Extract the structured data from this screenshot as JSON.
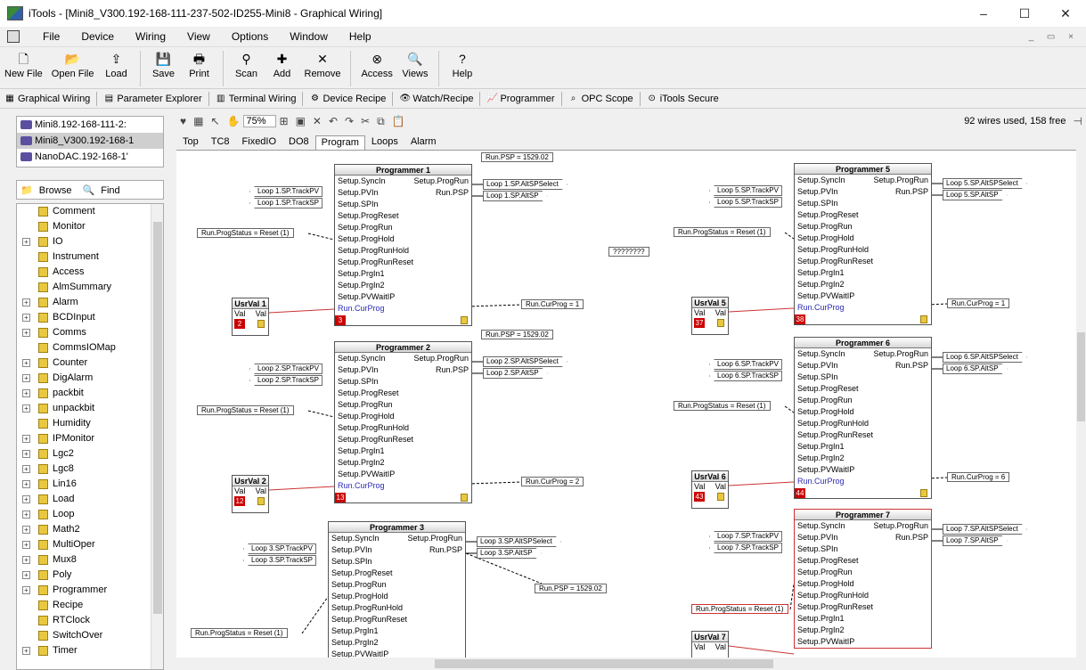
{
  "window": {
    "title": "iTools - [Mini8_V300.192-168-111-237-502-ID255-Mini8 - Graphical Wiring]",
    "min": "–",
    "max": "☐",
    "close": "✕"
  },
  "menu": [
    "File",
    "Device",
    "Wiring",
    "View",
    "Options",
    "Window",
    "Help"
  ],
  "toolbar": [
    {
      "label": "New File",
      "icon": "new-file-icon",
      "glyph": "🗋"
    },
    {
      "label": "Open File",
      "icon": "open-file-icon",
      "glyph": "📂"
    },
    {
      "label": "Load",
      "icon": "load-icon",
      "glyph": "⇪"
    },
    {
      "label": "Save",
      "icon": "save-icon",
      "glyph": "💾"
    },
    {
      "label": "Print",
      "icon": "print-icon",
      "glyph": "🖶"
    },
    {
      "label": "Scan",
      "icon": "scan-icon",
      "glyph": "⚲"
    },
    {
      "label": "Add",
      "icon": "add-icon",
      "glyph": "✚"
    },
    {
      "label": "Remove",
      "icon": "remove-icon",
      "glyph": "✕"
    },
    {
      "label": "Access",
      "icon": "access-icon",
      "glyph": "⊗"
    },
    {
      "label": "Views",
      "icon": "views-icon",
      "glyph": "🔍"
    },
    {
      "label": "Help",
      "icon": "help-icon",
      "glyph": "?"
    }
  ],
  "views": [
    "Graphical Wiring",
    "Parameter Explorer",
    "Terminal Wiring",
    "Device Recipe",
    "Watch/Recipe",
    "Programmer",
    "OPC Scope",
    "iTools Secure"
  ],
  "devices": [
    "Mini8.192-168-111-2:",
    "Mini8_V300.192-168-1",
    "NanoDAC.192-168-1'"
  ],
  "browse": "Browse",
  "find": "Find",
  "tree": [
    {
      "label": "Comment",
      "exp": false
    },
    {
      "label": "Monitor",
      "exp": false
    },
    {
      "label": "IO",
      "exp": true
    },
    {
      "label": "Instrument",
      "exp": false
    },
    {
      "label": "Access",
      "exp": false
    },
    {
      "label": "AlmSummary",
      "exp": false
    },
    {
      "label": "Alarm",
      "exp": true
    },
    {
      "label": "BCDInput",
      "exp": true
    },
    {
      "label": "Comms",
      "exp": true
    },
    {
      "label": "CommsIOMap",
      "exp": false
    },
    {
      "label": "Counter",
      "exp": true
    },
    {
      "label": "DigAlarm",
      "exp": true
    },
    {
      "label": "packbit",
      "exp": true
    },
    {
      "label": "unpackbit",
      "exp": true
    },
    {
      "label": "Humidity",
      "exp": false
    },
    {
      "label": "IPMonitor",
      "exp": true
    },
    {
      "label": "Lgc2",
      "exp": true
    },
    {
      "label": "Lgc8",
      "exp": true
    },
    {
      "label": "Lin16",
      "exp": true
    },
    {
      "label": "Load",
      "exp": true
    },
    {
      "label": "Loop",
      "exp": true
    },
    {
      "label": "Math2",
      "exp": true
    },
    {
      "label": "MultiOper",
      "exp": true
    },
    {
      "label": "Mux8",
      "exp": true
    },
    {
      "label": "Poly",
      "exp": true
    },
    {
      "label": "Programmer",
      "exp": true
    },
    {
      "label": "Recipe",
      "exp": false
    },
    {
      "label": "RTClock",
      "exp": false
    },
    {
      "label": "SwitchOver",
      "exp": false
    },
    {
      "label": "Timer",
      "exp": true
    }
  ],
  "zoom": "75%",
  "wires": "92 wires used, 158 free",
  "sheets": [
    "Top",
    "TC8",
    "FixedIO",
    "DO8",
    "Program",
    "Loops",
    "Alarm"
  ],
  "rows": [
    "Setup.SyncIn",
    "Setup.PVIn",
    "Setup.SPIn",
    "Setup.ProgReset",
    "Setup.ProgRun",
    "Setup.ProgHold",
    "Setup.ProgRunHold",
    "Setup.ProgRunReset",
    "Setup.PrgIn1",
    "Setup.PrgIn2",
    "Setup.PVWaitIP",
    "Run.CurProg"
  ],
  "outs": [
    "Setup.ProgRun",
    "Run.PSP"
  ],
  "programmers": [
    {
      "title": "Programmer 1",
      "id": "3",
      "uv": "UsrVal 1",
      "uvid": "2",
      "loop": "Loop 1",
      "psp": "Run.PSP = 1529.02",
      "status": "Run.ProgStatus = Reset (1)",
      "curprog": "Run.CurProg = 1"
    },
    {
      "title": "Programmer 2",
      "id": "13",
      "uv": "UsrVal 2",
      "uvid": "12",
      "loop": "Loop 2",
      "psp": "Run.PSP = 1529.02",
      "status": "Run.ProgStatus = Reset (1)",
      "curprog": "Run.CurProg = 2"
    },
    {
      "title": "Programmer 3",
      "id": "",
      "uv": "",
      "uvid": "",
      "loop": "Loop 3",
      "psp": "Run.PSP = 1529.02",
      "status": "Run.ProgStatus = Reset (1)",
      "curprog": ""
    },
    {
      "title": "Programmer 5",
      "id": "38",
      "uv": "UsrVal 5",
      "uvid": "37",
      "loop": "Loop 5",
      "psp": "",
      "status": "Run.ProgStatus = Reset (1)",
      "curprog": "Run.CurProg = 1"
    },
    {
      "title": "Programmer 6",
      "id": "44",
      "uv": "UsrVal 6",
      "uvid": "43",
      "loop": "Loop 6",
      "psp": "",
      "status": "Run.ProgStatus = Reset (1)",
      "curprog": "Run.CurProg = 6"
    },
    {
      "title": "Programmer 7",
      "id": "",
      "uv": "UsrVal 7",
      "uvid": "",
      "loop": "Loop 7",
      "psp": "",
      "status": "Run.ProgStatus = Reset (1)",
      "curprog": ""
    }
  ],
  "unknown": "????????",
  "val": "Val"
}
